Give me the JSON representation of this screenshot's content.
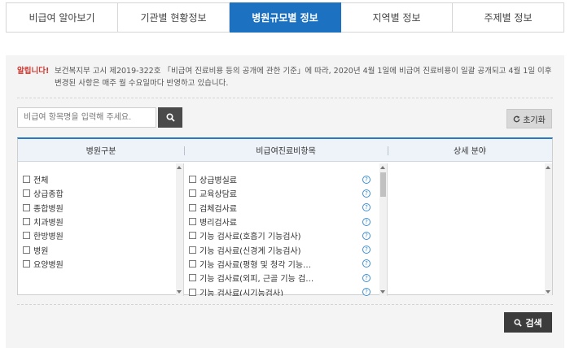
{
  "tabs": [
    {
      "label": "비급여 알아보기",
      "active": false
    },
    {
      "label": "기관별 현황정보",
      "active": false
    },
    {
      "label": "병원규모별 정보",
      "active": true
    },
    {
      "label": "지역별 정보",
      "active": false
    },
    {
      "label": "주제별 정보",
      "active": false
    }
  ],
  "notice": {
    "label": "알립니다!",
    "text": "보건복지부 고시 제2019-322호 「비급여 진료비용 등의 공개에 관한 기준」에 따라, 2020년 4월 1일에 비급여 진료비용이 일괄 공개되고 4월 1일 이후 변경된 사항은 매주 월 수요일마다 반영하고 있습니다."
  },
  "search": {
    "placeholder": "비급여 항목명을 입력해 주세요.",
    "value": ""
  },
  "reset_label": "초기화",
  "search_button_label": "검색",
  "table": {
    "headers": [
      "병원구분",
      "비급여진료비항목",
      "상세 분야"
    ],
    "hospital_types": [
      "전체",
      "상급종합",
      "종합병원",
      "치과병원",
      "한방병원",
      "병원",
      "요양병원"
    ],
    "items": [
      "상급병실료",
      "교육상담료",
      "검체검사료",
      "병리검사료",
      "기능 검사료(호흡기 기능검사)",
      "기능 검사료(신경계 기능검사)",
      "기능 검사료(평형 및 청각 기능…",
      "기능 검사료(외피, 근골 기능 검…",
      "기능 검사료(시기능검사)"
    ],
    "help_symbol": "?"
  },
  "colors": {
    "active_tab": "#1c72c0",
    "notice_label": "#d0342c",
    "table_top_border": "#2a79c6",
    "help_icon": "#3d8fd4",
    "dark_button": "#3c3c3c"
  }
}
